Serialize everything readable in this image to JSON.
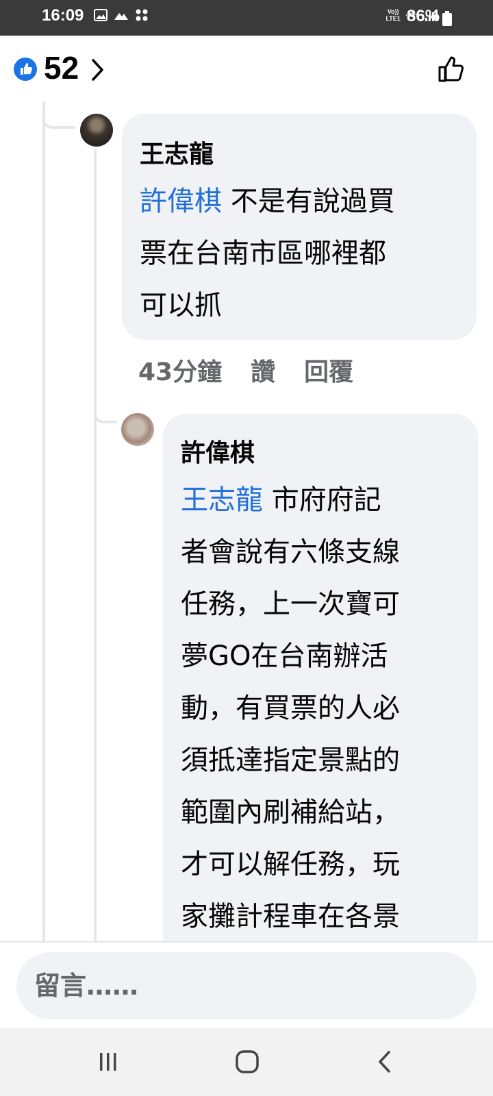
{
  "status_bar": {
    "time": "16:09",
    "battery_percent": "86%",
    "network_label_top": "Vo))",
    "network_label_bottom": "LTE1",
    "network_type": "4G+"
  },
  "reactions": {
    "like_count": "52",
    "accent_color": "#1b74e4"
  },
  "comments": [
    {
      "author": "王志龍",
      "mention": "許偉棋",
      "lines": [
        "不是有說過買",
        "票在台南市區哪裡都",
        "可以抓"
      ],
      "time": "43分鐘",
      "like_label": "讚",
      "reply_label": "回覆"
    },
    {
      "author": "許偉棋",
      "mention": "王志龍",
      "lines": [
        "市府府記",
        "者會說有六條支線",
        "任務，上一次寶可",
        "夢GO在台南辦活",
        "動，有買票的人必",
        "須抵達指定景點的",
        "範圍內刷補給站，",
        "才可以解任務，玩",
        "家攤計程車在各景"
      ]
    }
  ],
  "composer": {
    "placeholder": "留言……"
  },
  "nav": {
    "icons": [
      "recent-apps-icon",
      "home-icon",
      "back-icon"
    ]
  }
}
